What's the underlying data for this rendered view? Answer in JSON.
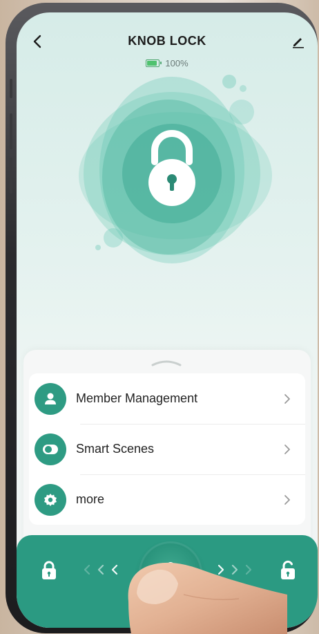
{
  "header": {
    "title": "KNOB LOCK",
    "back_icon": "chevron-left-icon",
    "edit_icon": "pencil-icon"
  },
  "battery": {
    "level_text": "100%",
    "level": 1.0,
    "icon": "battery-icon"
  },
  "status": {
    "icon": "padlock-icon",
    "state": "locked"
  },
  "menu": {
    "items": [
      {
        "label": "Member Management",
        "icon": "person-icon"
      },
      {
        "label": "Smart Scenes",
        "icon": "toggle-icon"
      },
      {
        "label": "more",
        "icon": "gear-icon"
      }
    ]
  },
  "slider": {
    "left_icon": "lock-icon",
    "right_icon": "unlock-icon",
    "knob_icon": "keyhole-icon"
  },
  "colors": {
    "accent": "#2b9a82",
    "accent_light": "#5cc4ae",
    "battery_green": "#4fc26f"
  }
}
